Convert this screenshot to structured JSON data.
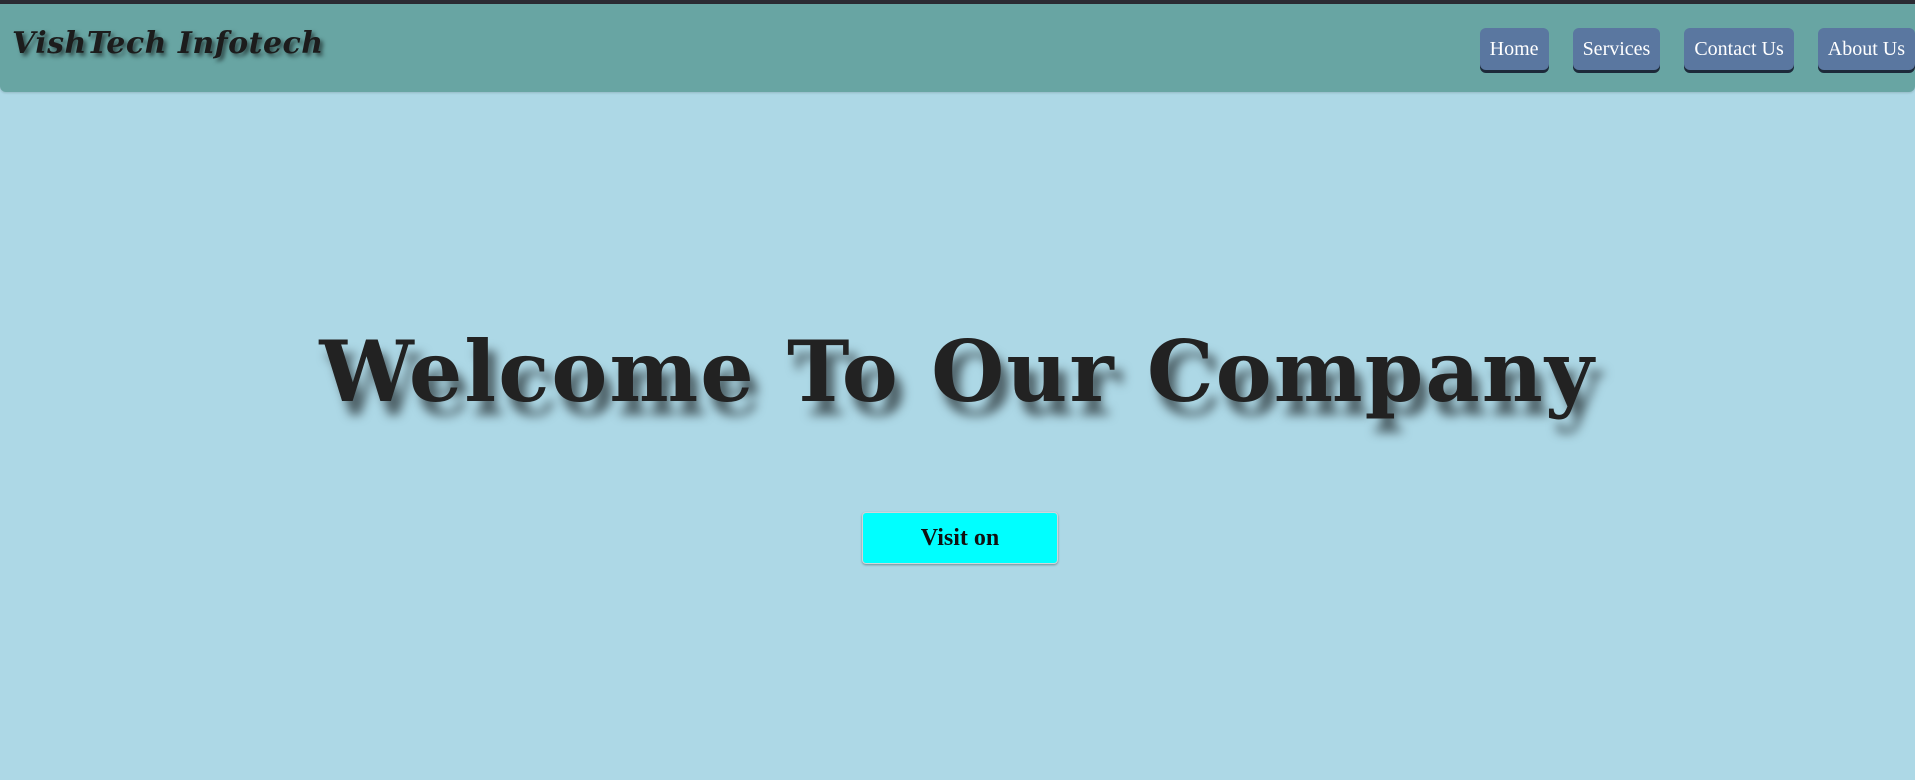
{
  "navbar": {
    "brand": "VishTech Infotech",
    "items": [
      {
        "label": "Home"
      },
      {
        "label": "Services"
      },
      {
        "label": "Contact Us"
      },
      {
        "label": "About Us"
      }
    ]
  },
  "hero": {
    "title": "Welcome To Our Company",
    "button_label": "Visit on"
  },
  "colors": {
    "page_background": "#add8e6",
    "navbar_background": "#68a5a3",
    "nav_button": "#5a77a0",
    "cta_button": "#00ffff"
  }
}
